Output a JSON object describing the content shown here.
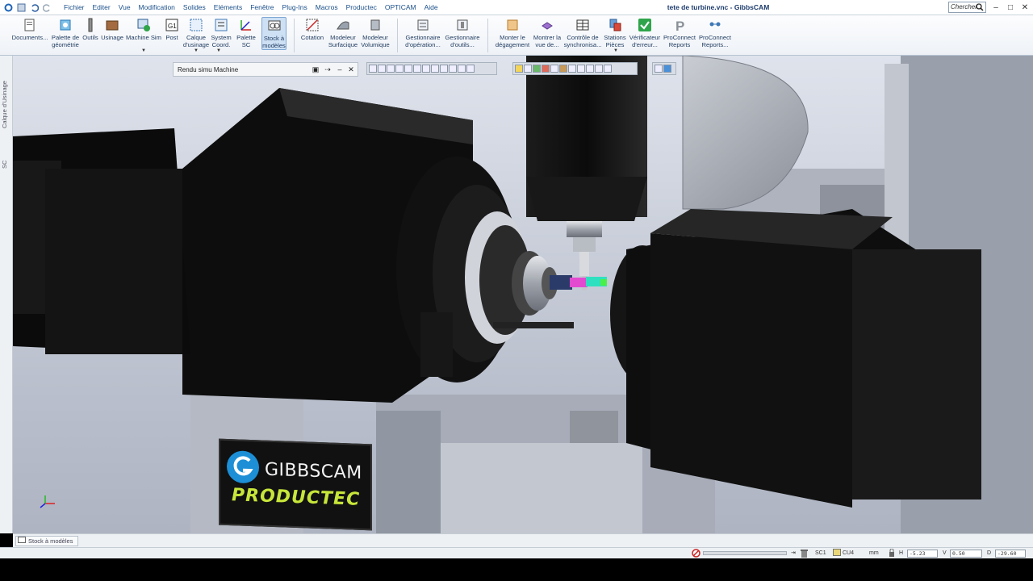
{
  "app": {
    "window_title": "tete de turbine.vnc - GibbsCAM",
    "search_label": "Chercher"
  },
  "menu": [
    "Fichier",
    "Editer",
    "Vue",
    "Modification",
    "Solides",
    "Eléments",
    "Fenêtre",
    "Plug-Ins",
    "Macros",
    "Productec",
    "OPTICAM",
    "Aide"
  ],
  "ribbon": [
    {
      "label": "Documents...",
      "icon": "documents-icon"
    },
    {
      "label": "Palette de géométrie",
      "icon": "geometry-palette-icon"
    },
    {
      "label": "Outils",
      "icon": "tools-icon"
    },
    {
      "label": "Usinage",
      "icon": "machining-icon"
    },
    {
      "label": "Machine Sim",
      "icon": "machine-sim-icon"
    },
    {
      "label": "Post",
      "icon": "post-icon"
    },
    {
      "label": "Calque d'usinage",
      "icon": "machining-layer-icon"
    },
    {
      "label": "System Coord.",
      "icon": "coord-system-icon"
    },
    {
      "label": "Palette SC",
      "icon": "sc-palette-icon"
    },
    {
      "label": "Stock à modèles",
      "icon": "stock-models-icon"
    },
    {
      "label": "Cotation",
      "icon": "dimension-icon"
    },
    {
      "label": "Modeleur Surfacique",
      "icon": "surface-modeler-icon"
    },
    {
      "label": "Modeleur Volumique",
      "icon": "solid-modeler-icon"
    },
    {
      "label": "Gestionnaire d'opération...",
      "icon": "operation-manager-icon"
    },
    {
      "label": "Gestionnaire d'outils...",
      "icon": "tool-manager-icon"
    },
    {
      "label": "Monter le dégagement",
      "icon": "clearance-icon"
    },
    {
      "label": "Montrer la vue de...",
      "icon": "show-view-icon"
    },
    {
      "label": "Contrôle de synchronisa...",
      "icon": "sync-control-icon"
    },
    {
      "label": "Stations Pièces",
      "icon": "part-stations-icon"
    },
    {
      "label": "Vérificateur d'erreur...",
      "icon": "error-checker-icon"
    },
    {
      "label": "ProConnect Reports",
      "icon": "proconnect-reports-icon"
    },
    {
      "label": "ProConnect Reports...",
      "icon": "proconnect-reports2-icon"
    }
  ],
  "left_dock": {
    "tab1": "Calque d'Usinage",
    "tab2": "SC"
  },
  "sim_panel": {
    "title": "Rendu simu Machine"
  },
  "logo": {
    "brand": "GIBBSCAM",
    "sub": "PRODUCTEC"
  },
  "bottom_tab": {
    "label": "Stock à modèles"
  },
  "status": {
    "sc_label": "SC1",
    "cu_label": "CU4",
    "units": "mm",
    "h_label": "H",
    "h_value": "-5.23",
    "v_label": "V",
    "v_value": "0.50",
    "d_label": "D",
    "d_value": "-29.60"
  },
  "colors": {
    "accent": "#1a4f8a",
    "logo_green": "#c7e63a",
    "viewport_bg": "#c9ceda"
  }
}
